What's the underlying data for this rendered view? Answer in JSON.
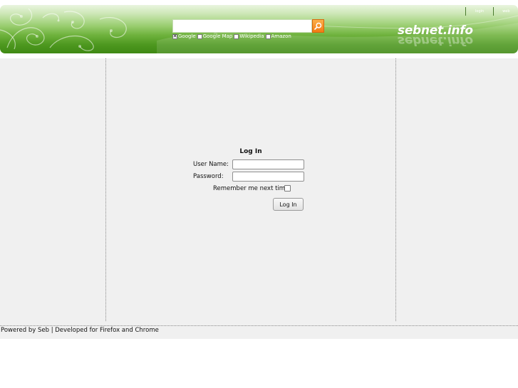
{
  "header": {
    "search": {
      "value": "",
      "placeholder": ""
    },
    "search_icon": "magnifier-icon",
    "engines": [
      {
        "label": "Google",
        "checked": true
      },
      {
        "label": "Google Map",
        "checked": false
      },
      {
        "label": "Wikipedia",
        "checked": false
      },
      {
        "label": "Amazon",
        "checked": false
      }
    ],
    "top_links": {
      "login": "login",
      "web": "web"
    },
    "logo": "sebnet.info"
  },
  "login": {
    "title": "Log In",
    "username_label": "User Name:",
    "username_value": "",
    "password_label": "Password:",
    "password_value": "",
    "remember_label": "Remember me next time.",
    "remember_checked": false,
    "button_label": "Log In"
  },
  "footer": {
    "text": "Powered by Seb | Developed for Firefox and Chrome"
  },
  "colors": {
    "header_green_dark": "#3f8914",
    "header_green_light": "#e9f5df",
    "search_button": "#f37a12",
    "content_bg": "#f0f0f0"
  }
}
